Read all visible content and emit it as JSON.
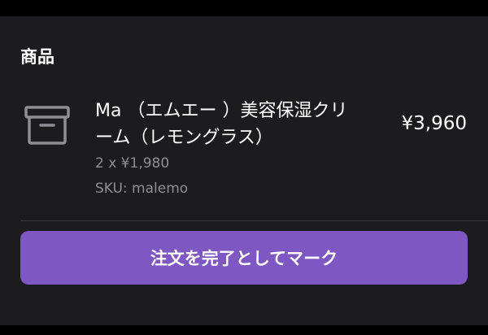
{
  "section": {
    "title": "商品"
  },
  "product": {
    "icon": "archive-box-icon",
    "name": "Ma （エムエー ）美容保湿クリーム（レモングラス）",
    "quantity_line": "2 x ¥1,980",
    "sku_line": "SKU: malemo",
    "total": "¥3,960"
  },
  "actions": {
    "mark_complete_label": "注文を完了としてマーク"
  },
  "colors": {
    "background": "#1c1c1e",
    "text_primary": "#ffffff",
    "text_secondary": "#8e8e93",
    "accent": "#7e57c2",
    "icon": "#8e8e93"
  }
}
